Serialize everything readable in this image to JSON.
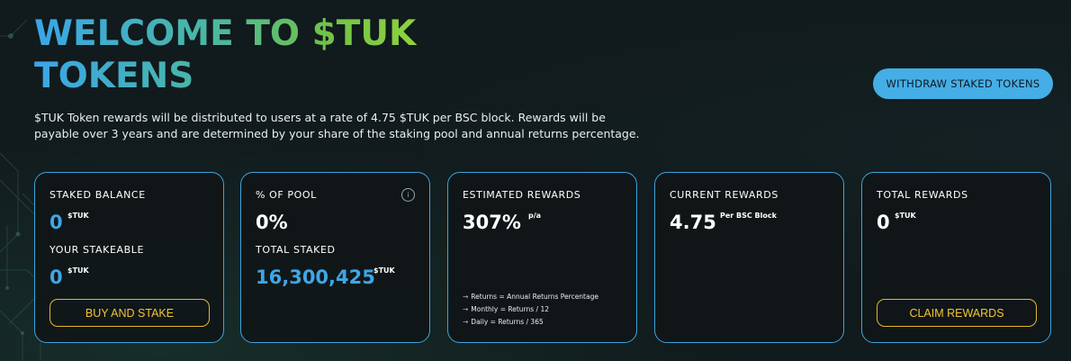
{
  "hero": {
    "title_line1": "WELCOME TO $TUK",
    "title_line2": "TOKENS",
    "description": "$TUK Token rewards will be distributed to users at a rate of 4.75 $TUK per BSC block. Rewards will be payable over 3 years and are determined by your share of the staking pool and annual returns percentage."
  },
  "header": {
    "withdraw_label": "WITHDRAW STAKED TOKENS"
  },
  "cards": {
    "staked": {
      "label": "STAKED BALANCE",
      "value": "0",
      "unit": "$TUK",
      "stakeable_label": "YOUR STAKEABLE",
      "stakeable_value": "0",
      "stakeable_unit": "$TUK",
      "button_label": "BUY AND STAKE"
    },
    "pool": {
      "label": "% OF POOL",
      "value": "0%",
      "info_icon": "i",
      "total_label": "TOTAL STAKED",
      "total_value": "16,300,425",
      "total_unit": "$TUK"
    },
    "estimated": {
      "label": "ESTIMATED REWARDS",
      "value": "307%",
      "unit": "p/a",
      "formulas": [
        "Returns = Annual Returns Percentage",
        "Monthly = Returns / 12",
        "Daily = Returns / 365"
      ],
      "arrow": "→"
    },
    "current": {
      "label": "CURRENT REWARDS",
      "value": "4.75",
      "unit": "Per BSC Block"
    },
    "total": {
      "label": "TOTAL REWARDS",
      "value": "0",
      "unit": "$TUK",
      "button_label": "CLAIM REWARDS"
    }
  },
  "colors": {
    "accent_blue": "#3fa6e6",
    "gold": "#e5b72c",
    "background": "#111a1c",
    "card_border": "#3ea3dc"
  }
}
